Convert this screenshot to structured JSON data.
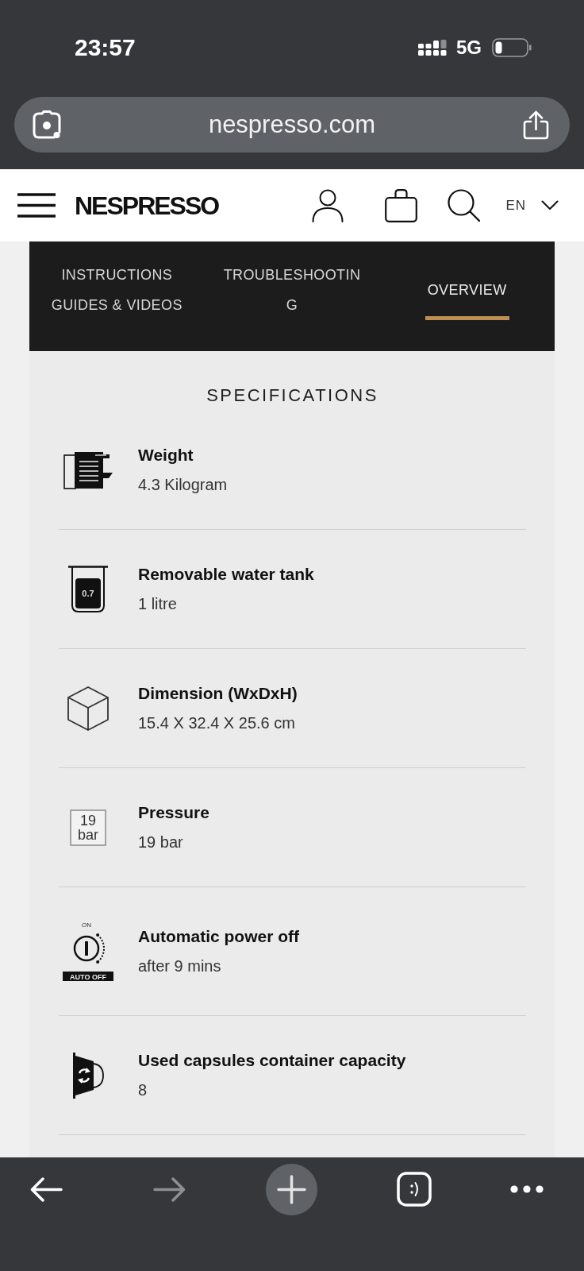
{
  "status_bar": {
    "time": "23:57",
    "network": "5G"
  },
  "address_bar": {
    "url": "nespresso.com"
  },
  "header": {
    "logo": "NESPRESSO",
    "language": "EN"
  },
  "tabs": [
    {
      "lines": [
        "INSTRUCTIONS",
        "GUIDES & VIDEOS"
      ],
      "selected": false
    },
    {
      "lines": [
        "TROUBLESHOOTIN",
        "G"
      ],
      "selected": false
    },
    {
      "lines": [
        "OVERVIEW"
      ],
      "selected": true
    }
  ],
  "specifications": {
    "title": "SPECIFICATIONS",
    "items": [
      {
        "kind": "machine",
        "label": "Weight",
        "value": "4.3 Kilogram"
      },
      {
        "kind": "tank",
        "label": "Removable water tank",
        "value": "1 litre",
        "icon_texts": [
          "0.7"
        ]
      },
      {
        "kind": "cube",
        "label": "Dimension (WxDxH)",
        "value": "15.4 X 32.4 X 25.6 cm"
      },
      {
        "kind": "pressure",
        "label": "Pressure",
        "value": "19 bar",
        "icon_texts": [
          "19",
          "bar"
        ]
      },
      {
        "kind": "power",
        "label": "Automatic power off",
        "value": "after 9 mins",
        "icon_texts": [
          "ON",
          "AUTO OFF"
        ]
      },
      {
        "kind": "capsule",
        "label": "Used capsules container capacity",
        "value": "8"
      }
    ]
  },
  "toolbar": [
    {
      "kind": "back",
      "disabled": false
    },
    {
      "kind": "forward",
      "disabled": true
    },
    {
      "kind": "new_tab",
      "disabled": false
    },
    {
      "kind": "tabs",
      "disabled": false
    },
    {
      "kind": "more",
      "disabled": false
    }
  ]
}
